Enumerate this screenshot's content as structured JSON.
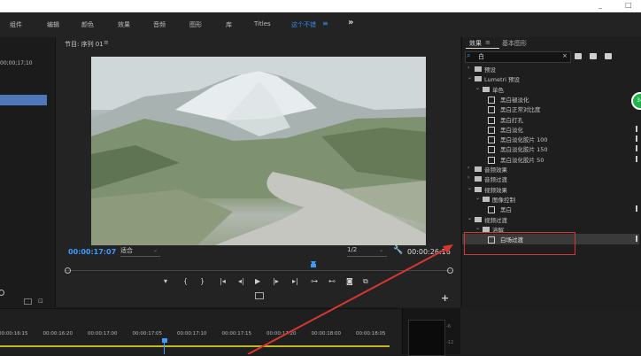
{
  "topbar": {
    "controls": [
      "_",
      "□"
    ]
  },
  "workspaces": {
    "items": [
      "组件",
      "编辑",
      "颜色",
      "效果",
      "音频",
      "图形",
      "库",
      "Titles"
    ],
    "active": "这个不错",
    "active_menu_icon": "≡",
    "more": "»"
  },
  "source": {
    "timecode": "00;00;17;10"
  },
  "program": {
    "title": "节目: 序列 01",
    "menu_icon": "≡",
    "current_timecode": "00:00:17:07",
    "fit_label": "适合",
    "resolution_label": "1/2",
    "duration_timecode": "00:00:26:16",
    "transport": [
      "▾",
      "{",
      "}",
      "|◂",
      "◂|",
      "▶",
      "|▸",
      "▸|",
      "⊶",
      "⊷",
      "◙",
      "⧉"
    ],
    "add_label": "+"
  },
  "effects": {
    "tab_active": "效果",
    "tab_menu_icon": "≡",
    "tab_other": "基本图形",
    "search_value": "白",
    "search_clear": "×",
    "tree": [
      {
        "label": "预设",
        "indent": 0,
        "kind": "folder",
        "arrow": "›"
      },
      {
        "label": "Lumetri 预设",
        "indent": 0,
        "kind": "folder",
        "arrow": "⌄"
      },
      {
        "label": "单色",
        "indent": 1,
        "kind": "folder",
        "arrow": "⌄"
      },
      {
        "label": "黑白褪淡化",
        "indent": 2,
        "kind": "preset",
        "flag": false
      },
      {
        "label": "黑白正常对比度",
        "indent": 2,
        "kind": "preset",
        "flag": false
      },
      {
        "label": "黑白打孔",
        "indent": 2,
        "kind": "preset",
        "flag": false
      },
      {
        "label": "黑白淡化",
        "indent": 2,
        "kind": "preset",
        "flag": true
      },
      {
        "label": "黑白淡化胶片 100",
        "indent": 2,
        "kind": "preset",
        "flag": true
      },
      {
        "label": "黑白淡化胶片 150",
        "indent": 2,
        "kind": "preset",
        "flag": true
      },
      {
        "label": "黑白淡化胶片 50",
        "indent": 2,
        "kind": "preset",
        "flag": true
      },
      {
        "label": "音频效果",
        "indent": 0,
        "kind": "folder",
        "arrow": "›"
      },
      {
        "label": "音频过渡",
        "indent": 0,
        "kind": "folder",
        "arrow": "›"
      },
      {
        "label": "视频效果",
        "indent": 0,
        "kind": "folder",
        "arrow": "⌄"
      },
      {
        "label": "图像控制",
        "indent": 1,
        "kind": "folder",
        "arrow": "⌄"
      },
      {
        "label": "黑白",
        "indent": 2,
        "kind": "preset",
        "flag": true
      },
      {
        "label": "视频过渡",
        "indent": 0,
        "kind": "folder",
        "arrow": "⌄"
      },
      {
        "label": "溶解",
        "indent": 1,
        "kind": "folder",
        "arrow": "⌄"
      },
      {
        "label": "白场过渡",
        "indent": 2,
        "kind": "preset",
        "flag": true,
        "selected": true
      }
    ],
    "badge": "34"
  },
  "timeline": {
    "ruler": [
      "00:00:16:15",
      "00:00:16:20",
      "00:00:17:00",
      "00:00:17:05",
      "00:00:17:10",
      "00:00:17:15",
      "00:00:17:20",
      "00:00:18:00",
      "00:00:18:05"
    ]
  },
  "meter": {
    "ticks": [
      "-6",
      "-12"
    ]
  },
  "colors": {
    "accent": "#2d8ceb",
    "highlight": "#d8372f",
    "badge": "#21b24a"
  }
}
